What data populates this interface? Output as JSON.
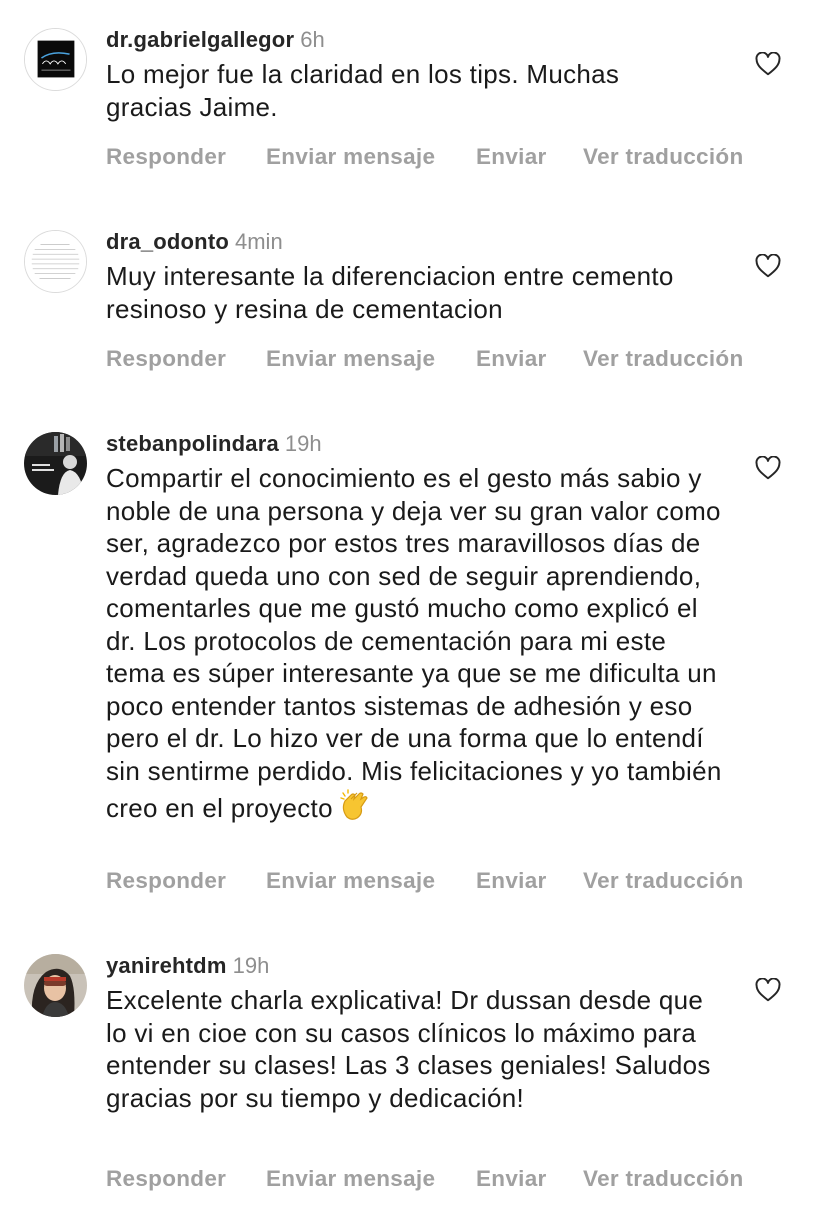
{
  "comments": [
    {
      "username": "dr.gabrielgallegor",
      "time": "6h",
      "text": "Lo mejor fue la claridad en los tips. Muchas gracias Jaime.",
      "avatar_icon": "clinic-logo-avatar",
      "actions": [
        "Responder",
        "Enviar mensaje",
        "Enviar",
        "Ver traducción"
      ]
    },
    {
      "username": "dra_odonto",
      "time": "4min",
      "text": "Muy interesante la diferenciacion entre cemento resinoso y resina de cementacion",
      "avatar_icon": "text-document-avatar",
      "actions": [
        "Responder",
        "Enviar mensaje",
        "Enviar",
        "Ver traducción"
      ]
    },
    {
      "username": "stebanpolindara",
      "time": "19h",
      "text": "Compartir el conocimiento es el gesto más sabio y noble de una persona y deja ver su gran valor como ser, agradezco por estos tres maravillosos días de verdad queda uno con sed de seguir aprendiendo, comentarles que me gustó mucho como explicó el dr. Los protocolos de cementación para mi este tema es súper interesante ya que se me dificulta un poco entender tantos sistemas de adhesión y eso pero el dr. Lo hizo ver de una forma que lo entendí sin sentirme perdido. Mis felicitaciones y yo también creo en el proyecto",
      "emoji": "clapping-hands-icon",
      "avatar_icon": "doctor-photo-avatar",
      "actions": [
        "Responder",
        "Enviar mensaje",
        "Enviar",
        "Ver traducción"
      ]
    },
    {
      "username": "yanirehtdm",
      "time": "19h",
      "text": "Excelente charla explicativa! Dr dussan desde que lo vi en cioe con su casos clínicos lo máximo para entender su clases! Las 3 clases geniales! Saludos gracias por su tiempo y dedicación!",
      "avatar_icon": "person-photo-avatar",
      "actions": [
        "Responder",
        "Enviar mensaje",
        "Enviar",
        "Ver traducción"
      ]
    }
  ],
  "colors": {
    "username": "#262626",
    "meta": "#8e8e8e",
    "actions": "#a0a0a0",
    "text": "#1a1a1a"
  }
}
